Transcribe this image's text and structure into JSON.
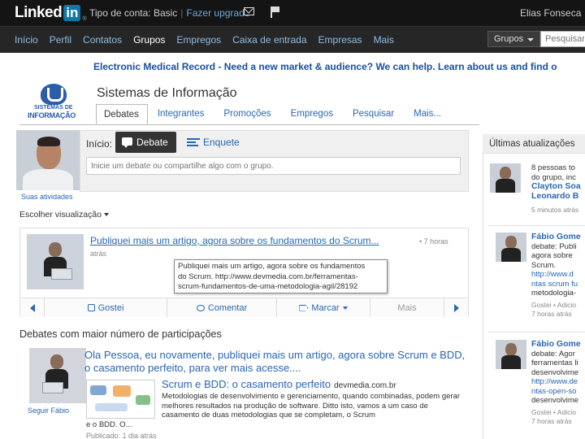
{
  "topbar": {
    "logo_word": "Linked",
    "logo_in": "in",
    "logo_reg": "®",
    "account_type": "Tipo de conta: Basic",
    "upgrade_link": "Fazer upgrade",
    "user_name": "Elias Fonseca",
    "icons": [
      "mail-icon",
      "flag-icon"
    ]
  },
  "nav": {
    "items": [
      "Início",
      "Perfil",
      "Contatos",
      "Grupos",
      "Empregos",
      "Caixa de entrada",
      "Empresas",
      "Mais"
    ],
    "active": "Grupos",
    "search_scope": "Grupos",
    "search_placeholder": "Pesquisar"
  },
  "ad": {
    "text": "Electronic Medical Record - Need a new market & audience? We can help. Learn about us and find o"
  },
  "group": {
    "logo_text_small": "SISTEMAS DE",
    "logo_text_big": "INFORMAÇÃO",
    "title": "Sistemas de Informação",
    "tabs": [
      "Debates",
      "Integrantes",
      "Promoções",
      "Empregos",
      "Pesquisar",
      "Mais..."
    ],
    "active_tab": "Debates"
  },
  "start": {
    "label": "Início:",
    "debate_button": "Debate",
    "enquete_button": "Enquete",
    "input_placeholder": "Inicie um debate ou compartilhe algo com o grupo.",
    "activity_link": "Suas atividades"
  },
  "view_selector": {
    "label": "Escolher visualização"
  },
  "post": {
    "title": "Publiquei mais um artigo, agora sobre os fundamentos do Scrum...",
    "time_a": "• 7 horas",
    "time_b": "atrás",
    "tooltip_line1": "Publiquei mais um artigo, agora sobre os fundamentos",
    "tooltip_line2": "do Scrum. http://www.devmedia.com.br/ferramentas-",
    "tooltip_line3": "scrum-fundamentos-de-uma-metodologia-agil/28192",
    "actions": {
      "like": "Gostei",
      "comment": "Comentar",
      "tag": "Marcar",
      "more": "Mais"
    }
  },
  "popular": {
    "heading": "Debates com maior número de participações",
    "follow": "Seguir Fábio",
    "title": "Ola Pessoa, eu novamente, publiquei mais um artigo, agora sobre Scrum e BDD, o casamento perfeito, para ver mais acesse....",
    "link_title": "Scrum e BDD: o casamento perfeito",
    "link_source": "devmedia.com.br",
    "link_desc": "Metodologias de desenvolvimento e gerenciamento, quando combinadas, podem gerar melhores resultados na produção de software. Ditto isto, vamos a um caso de casamento de duas metodologias que se completam, o Scrum",
    "link_desc_tail": "e o BDD. O...",
    "time": "Publicado: 1 dia atrás"
  },
  "updates": {
    "header": "Últimas atualizações",
    "items": [
      {
        "line1": "8 pessoas to",
        "line2": "do grupo, inc",
        "name1": "Clayton Soa",
        "name2": "Leonardo B",
        "meta": "5 minutos atrás"
      },
      {
        "name": "Fábio Gome",
        "l1": "debate: Publi",
        "l2": "agora sobre",
        "l3": "Scrum.",
        "link1": "http://www.d",
        "link2": "ntas scrum fu",
        "l4": "metodologia-",
        "meta1": "Gostei • Adicio",
        "meta2": "7 horas atrás"
      },
      {
        "name": "Fábio Gome",
        "l1": "debate: Agor",
        "l2": "ferramentas li",
        "l3": "desenvolvime",
        "link1": "http://www.de",
        "link2": "ntas-open-so",
        "l4": "desenvolvime",
        "meta1": "Gostei • Adicio",
        "meta2": "7 horas atrás"
      }
    ]
  },
  "colors": {
    "topbar": "#141414",
    "navbar": "#262626",
    "link": "#2a66b2",
    "brand": "#0e76a8"
  }
}
